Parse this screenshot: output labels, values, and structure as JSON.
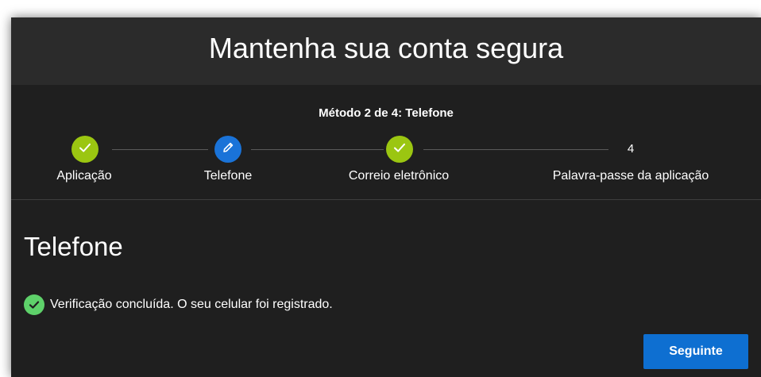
{
  "header": {
    "title": "Mantenha sua conta segura"
  },
  "progress": {
    "method_title": "Método 2 de 4: Telefone",
    "steps": [
      {
        "label": "Aplicação",
        "state": "done",
        "icon": "checkmark-icon"
      },
      {
        "label": "Telefone",
        "state": "current",
        "icon": "pencil-icon"
      },
      {
        "label": "Correio eletrônico",
        "state": "done",
        "icon": "checkmark-icon"
      },
      {
        "label": "Palavra-passe da aplicação",
        "state": "pending",
        "number": "4"
      }
    ]
  },
  "section": {
    "title": "Telefone",
    "status_icon": "checkmark-circle-icon",
    "status_text": "Verificação concluída. O seu celular foi registrado."
  },
  "actions": {
    "next_label": "Seguinte"
  },
  "colors": {
    "background": "#1f1f1f",
    "header": "#2b2b2b",
    "step_done": "#9bc611",
    "step_current": "#1a73d8",
    "success": "#5ed16a",
    "button": "#0e6fd1"
  }
}
